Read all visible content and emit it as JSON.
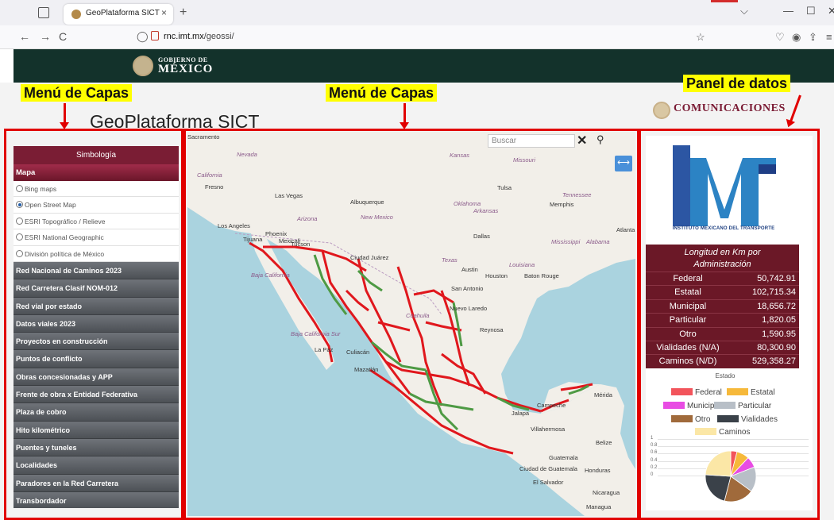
{
  "browser": {
    "tab_title": "GeoPlataforma SICT",
    "tab_close": "×",
    "new_tab": "+",
    "url_domain": "rnc.imt.mx",
    "url_path": "/geossi/",
    "nav_back": "←",
    "nav_forward": "→",
    "nav_reload": "C"
  },
  "header": {
    "gob_line1": "GOBIERNO DE",
    "gob_line2": "MÉXICO",
    "page_title": "GeoPlataforma SICT",
    "ministry": "COMUNICACIONES"
  },
  "annotations": {
    "left_label": "Menú de Capas",
    "center_label": "Menú de Capas",
    "right_label": "Panel de datos",
    "box_color": "#e10000",
    "label_bg": "#ffff00"
  },
  "menu": {
    "title": "Simbología",
    "section": "Mapa",
    "basemaps": [
      {
        "label": "Bing maps",
        "selected": false
      },
      {
        "label": "Open Street Map",
        "selected": true
      },
      {
        "label": "ESRI Topográfico / Relieve",
        "selected": false
      },
      {
        "label": "ESRI National Geographic",
        "selected": false
      },
      {
        "label": "División política de México",
        "selected": false
      }
    ],
    "layers": [
      "Red Nacional de Caminos 2023",
      "Red Carretera Clasif NOM-012",
      "Red vial por estado",
      "Datos viales 2023",
      "Proyectos en construcción",
      "Puntos de conflicto",
      "Obras concesionadas y APP",
      "Frente de obra x Entidad Federativa",
      "Plaza de cobro",
      "Hito kilométrico",
      "Puentes y tuneles",
      "Localidades",
      "Paradores en la Red Carretera",
      "Transbordador"
    ]
  },
  "map": {
    "search_placeholder": "Buscar",
    "search_clear": "✕",
    "cities": [
      {
        "name": "Sacramento",
        "style": "n"
      },
      {
        "name": "Nevada",
        "style": "it"
      },
      {
        "name": "California",
        "style": "it"
      },
      {
        "name": "Fresno",
        "style": "n"
      },
      {
        "name": "Las Vegas",
        "style": "n"
      },
      {
        "name": "Albuquerque",
        "style": "n"
      },
      {
        "name": "Arizona",
        "style": "it"
      },
      {
        "name": "New Mexico",
        "style": "it"
      },
      {
        "name": "Los Angeles",
        "style": "n"
      },
      {
        "name": "Phoenix",
        "style": "n"
      },
      {
        "name": "Tijuana",
        "style": "n"
      },
      {
        "name": "Mexicali",
        "style": "n"
      },
      {
        "name": "Tucson",
        "style": "n"
      },
      {
        "name": "Kansas",
        "style": "it"
      },
      {
        "name": "Missouri",
        "style": "it"
      },
      {
        "name": "Tulsa",
        "style": "n"
      },
      {
        "name": "Oklahoma",
        "style": "it"
      },
      {
        "name": "Arkansas",
        "style": "it"
      },
      {
        "name": "Tennessee",
        "style": "it"
      },
      {
        "name": "Memphis",
        "style": "n"
      },
      {
        "name": "Dallas",
        "style": "n"
      },
      {
        "name": "Mississippi",
        "style": "it"
      },
      {
        "name": "Alabama",
        "style": "it"
      },
      {
        "name": "Atlanta",
        "style": "n"
      },
      {
        "name": "Texas",
        "style": "it"
      },
      {
        "name": "Louisiana",
        "style": "it"
      },
      {
        "name": "Austin",
        "style": "n"
      },
      {
        "name": "Houston",
        "style": "n"
      },
      {
        "name": "Baton Rouge",
        "style": "n"
      },
      {
        "name": "San Antonio",
        "style": "n"
      },
      {
        "name": "Ciudad Juárez",
        "style": "n"
      },
      {
        "name": "Nuevo Laredo",
        "style": "n"
      },
      {
        "name": "Coahuila",
        "style": "it"
      },
      {
        "name": "Reynosa",
        "style": "n"
      },
      {
        "name": "Baja California",
        "style": "it"
      },
      {
        "name": "Baja California Sur",
        "style": "it"
      },
      {
        "name": "La Paz",
        "style": "n"
      },
      {
        "name": "Culiacán",
        "style": "n"
      },
      {
        "name": "Mazatlán",
        "style": "n"
      },
      {
        "name": "Mérida",
        "style": "n"
      },
      {
        "name": "Campeche",
        "style": "n"
      },
      {
        "name": "Jalapa",
        "style": "n"
      },
      {
        "name": "Villahermosa",
        "style": "n"
      },
      {
        "name": "Belize",
        "style": "n"
      },
      {
        "name": "Guatemala",
        "style": "n"
      },
      {
        "name": "Ciudad de Guatemala",
        "style": "n"
      },
      {
        "name": "Honduras",
        "style": "n"
      },
      {
        "name": "El Salvador",
        "style": "n"
      },
      {
        "name": "Nicaragua",
        "style": "n"
      },
      {
        "name": "Managua",
        "style": "n"
      }
    ],
    "colors": {
      "water": "#aad3df",
      "land": "#f2efe9",
      "primary_road": "#e0171d",
      "federal_road": "#4e9a44"
    }
  },
  "panel": {
    "logo_caption": "INSTITUTO MEXICANO DEL TRANSPORTE",
    "table_title_1": "Longitud en Km por",
    "table_title_2": "Administración",
    "rows": [
      {
        "label": "Federal",
        "value": "50,742.91"
      },
      {
        "label": "Estatal",
        "value": "102,715.34"
      },
      {
        "label": "Municipal",
        "value": "18,656.72"
      },
      {
        "label": "Particular",
        "value": "1,820.05"
      },
      {
        "label": "Otro",
        "value": "1,590.95"
      },
      {
        "label": "Vialidades (N/A)",
        "value": "80,300.90"
      },
      {
        "label": "Caminos (N/D)",
        "value": "529,358.27"
      }
    ]
  },
  "chart_data": {
    "type": "pie",
    "title": "Estado",
    "categories": [
      "Federal",
      "Estatal",
      "Municipal",
      "Particular",
      "Otro",
      "Vialidades",
      "Caminos"
    ],
    "colors": [
      "#f2545b",
      "#f6b93b",
      "#e84ce3",
      "#b8bfc7",
      "#a06a3b",
      "#3a4149",
      "#fbe7a6"
    ],
    "values": [
      0.04,
      0.08,
      0.07,
      0.16,
      0.19,
      0.22,
      0.24
    ],
    "yticks": [
      "1",
      "0.8",
      "0.6",
      "0.4",
      "0.2",
      "0"
    ]
  }
}
